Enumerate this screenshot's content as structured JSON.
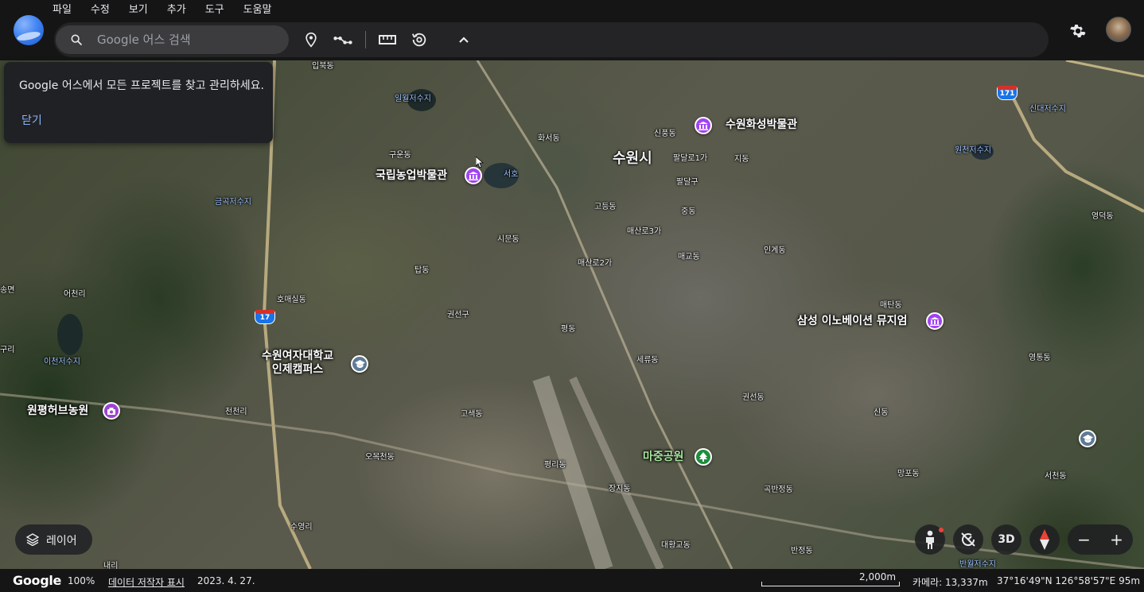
{
  "menu": [
    "파일",
    "수정",
    "보기",
    "추가",
    "도구",
    "도움말"
  ],
  "search": {
    "placeholder": "Google 어스 검색"
  },
  "toolbar": {
    "icons": [
      "placemark-icon",
      "path-icon",
      "ruler-icon",
      "history-icon",
      "chevron-up-icon"
    ]
  },
  "popup": {
    "text": "Google 어스에서 모든 프로젝트를 찾고 관리하세요.",
    "close_label": "닫기"
  },
  "map": {
    "city": "수원시",
    "pois": [
      {
        "label": "수원화성박물관",
        "type": "museum"
      },
      {
        "label": "국립농업박물관",
        "type": "museum"
      },
      {
        "label": "삼성 이노베이션 뮤지엄",
        "type": "museum"
      },
      {
        "label": "수원여자대학교\n인제캠퍼스",
        "type": "education"
      },
      {
        "label": "원평허브농원",
        "type": "garden"
      },
      {
        "label": "마중공원",
        "type": "park"
      }
    ],
    "places": [
      "입북동",
      "일월저수지",
      "화서동",
      "신풍동",
      "팔달로1가",
      "지동",
      "구운동",
      "서호",
      "팔달구",
      "고등동",
      "중동",
      "매산로3가",
      "매교동",
      "인계동",
      "시문동",
      "매산로2가",
      "탑동",
      "호매실동",
      "권선구",
      "평동",
      "세류동",
      "매탄동",
      "권선동",
      "고색동",
      "천천리",
      "오목천동",
      "평리동",
      "장지동",
      "곡반정동",
      "신동",
      "망포동",
      "서천동",
      "영통동",
      "영덕동",
      "원천저수지",
      "신대저수지",
      "금곡저수지",
      "어천리",
      "이천저수지",
      "송면",
      "구리",
      "수영리",
      "내리",
      "대황교동",
      "반정동",
      "반월저수지",
      "망포"
    ],
    "water_places": [
      "일월저수지",
      "서호",
      "금곡저수지",
      "이천저수지",
      "원천저수지",
      "신대저수지"
    ],
    "route_shields": [
      "17",
      "171"
    ]
  },
  "controls": {
    "layers_label": "레이어",
    "btn_3d": "3D",
    "zoom_out": "−",
    "zoom_in": "+"
  },
  "status": {
    "brand": "Google",
    "zoom": "100%",
    "data_attribution": "데이터 저작자 표시",
    "imagery_date": "2023. 4. 27.",
    "scale_label": "2,000m",
    "camera": "카메라: 13,337m",
    "coords": "37°16'49\"N 126°58'57\"E  95m"
  },
  "colors": {
    "topbar": "#151516",
    "toolbar": "#242426",
    "search_bg": "#3c3c3f",
    "link": "#8ab4f8",
    "museum_pin": "#a142f4",
    "park_pin": "#1e8e3e"
  }
}
